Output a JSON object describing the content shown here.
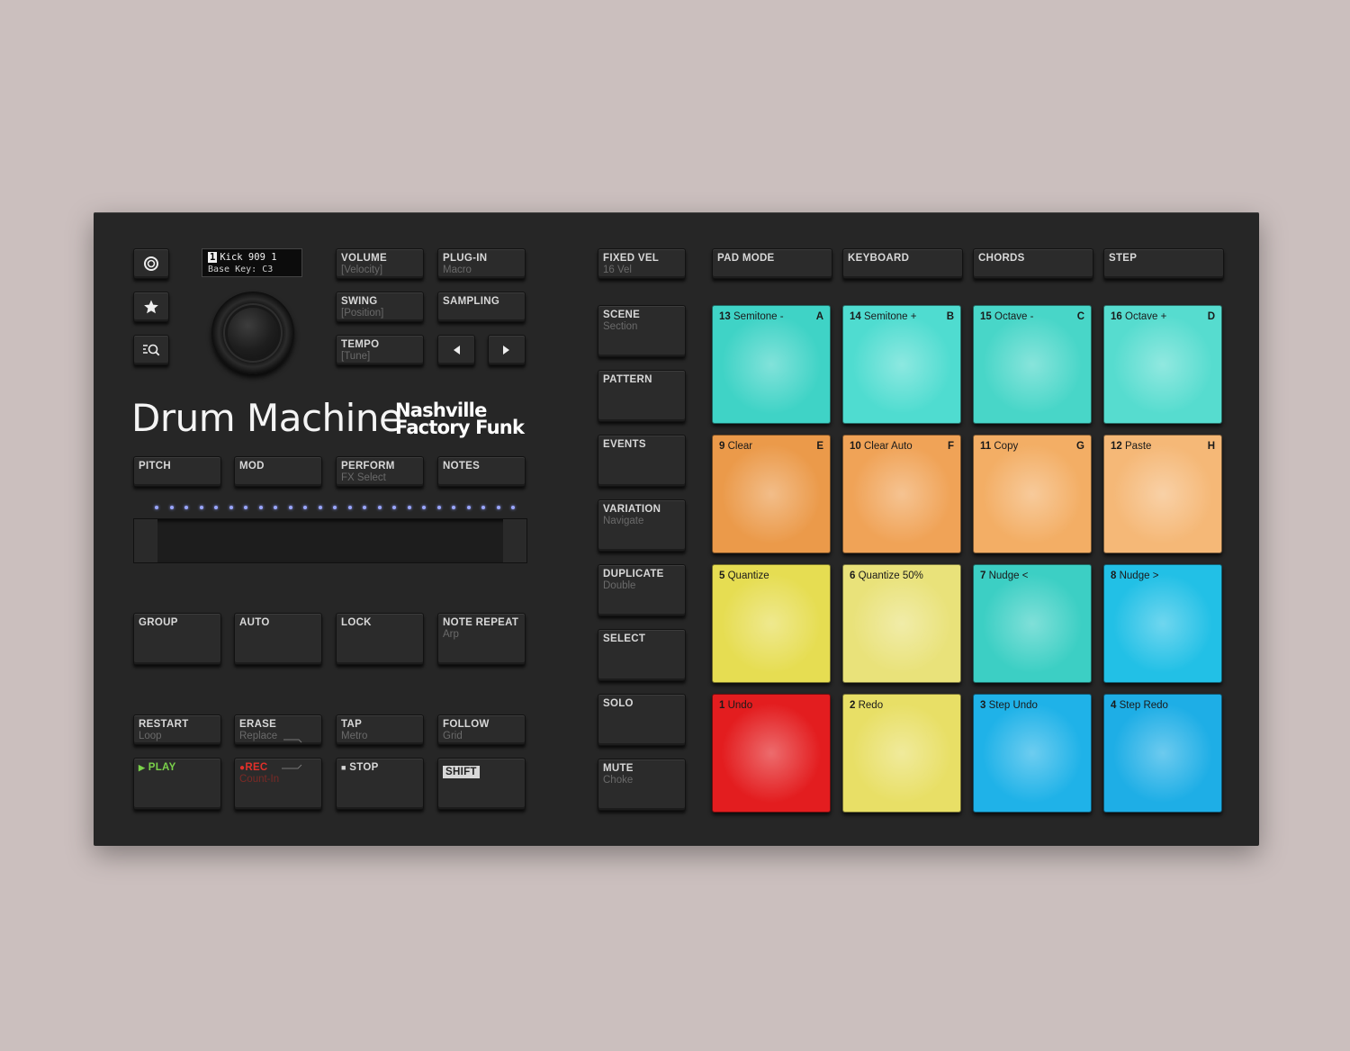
{
  "display": {
    "track_num": "1",
    "track_name": "Kick 909 1",
    "base_key": "Base Key: C3"
  },
  "branding": {
    "title": "Drum Machine",
    "subtitle_line1": "Nashville",
    "subtitle_line2": "Factory Funk"
  },
  "left_icons": [
    "record-circle-icon",
    "star-icon",
    "browse-search-icon"
  ],
  "top_buttons": {
    "volume": {
      "label": "VOLUME",
      "sub": "[Velocity]"
    },
    "plugin": {
      "label": "PLUG-IN",
      "sub": "Macro"
    },
    "swing": {
      "label": "SWING",
      "sub": "[Position]"
    },
    "sampling": {
      "label": "SAMPLING",
      "sub": ""
    },
    "tempo": {
      "label": "TEMPO",
      "sub": "[Tune]"
    }
  },
  "mode_row": {
    "pitch": {
      "label": "PITCH"
    },
    "mod": {
      "label": "MOD"
    },
    "perform": {
      "label": "PERFORM",
      "sub": "FX Select"
    },
    "notes": {
      "label": "NOTES"
    }
  },
  "group_row": {
    "group": {
      "label": "GROUP"
    },
    "auto": {
      "label": "AUTO"
    },
    "lock": {
      "label": "LOCK"
    },
    "note_repeat": {
      "label": "NOTE REPEAT",
      "sub": "Arp"
    }
  },
  "transport_top": {
    "restart": {
      "label": "RESTART",
      "sub": "Loop"
    },
    "erase": {
      "label": "ERASE",
      "sub": "Replace"
    },
    "tap": {
      "label": "TAP",
      "sub": "Metro"
    },
    "follow": {
      "label": "FOLLOW",
      "sub": "Grid"
    }
  },
  "transport_bottom": {
    "play": {
      "label": "PLAY",
      "color": "#7ad14a"
    },
    "rec": {
      "label": "REC",
      "sub": "Count-In",
      "color": "#e0302a"
    },
    "stop": {
      "label": "STOP"
    },
    "shift": {
      "label": "SHIFT"
    }
  },
  "mid_column": [
    {
      "label": "FIXED VEL",
      "sub": "16 Vel"
    },
    {
      "label": "SCENE",
      "sub": "Section"
    },
    {
      "label": "PATTERN",
      "sub": ""
    },
    {
      "label": "EVENTS",
      "sub": ""
    },
    {
      "label": "VARIATION",
      "sub": "Navigate"
    },
    {
      "label": "DUPLICATE",
      "sub": "Double"
    },
    {
      "label": "SELECT",
      "sub": ""
    },
    {
      "label": "SOLO",
      "sub": ""
    },
    {
      "label": "MUTE",
      "sub": "Choke"
    }
  ],
  "pad_modes": [
    "PAD MODE",
    "KEYBOARD",
    "CHORDS",
    "STEP"
  ],
  "pads": [
    {
      "num": "13",
      "name": "Semitone -",
      "key": "A",
      "color": "#3fd3c6"
    },
    {
      "num": "14",
      "name": "Semitone +",
      "key": "B",
      "color": "#4fdcd0"
    },
    {
      "num": "15",
      "name": "Octave -",
      "key": "C",
      "color": "#48d6c8"
    },
    {
      "num": "16",
      "name": "Octave +",
      "key": "D",
      "color": "#56dccf"
    },
    {
      "num": "9",
      "name": "Clear",
      "key": "E",
      "color": "#eb9a4a"
    },
    {
      "num": "10",
      "name": "Clear Auto",
      "key": "F",
      "color": "#f0a357"
    },
    {
      "num": "11",
      "name": "Copy",
      "key": "G",
      "color": "#f3ae65"
    },
    {
      "num": "12",
      "name": "Paste",
      "key": "H",
      "color": "#f5b877"
    },
    {
      "num": "5",
      "name": "Quantize",
      "key": "",
      "color": "#e6dd52"
    },
    {
      "num": "6",
      "name": "Quantize 50%",
      "key": "",
      "color": "#e9e27a"
    },
    {
      "num": "7",
      "name": "Nudge <",
      "key": "",
      "color": "#3ccfc4"
    },
    {
      "num": "8",
      "name": "Nudge >",
      "key": "",
      "color": "#22c0e6"
    },
    {
      "num": "1",
      "name": "Undo",
      "key": "",
      "color": "#e31d1f"
    },
    {
      "num": "2",
      "name": "Redo",
      "key": "",
      "color": "#e8df66"
    },
    {
      "num": "3",
      "name": "Step Undo",
      "key": "",
      "color": "#1fb2e8"
    },
    {
      "num": "4",
      "name": "Step Redo",
      "key": "",
      "color": "#1eaee6"
    }
  ]
}
